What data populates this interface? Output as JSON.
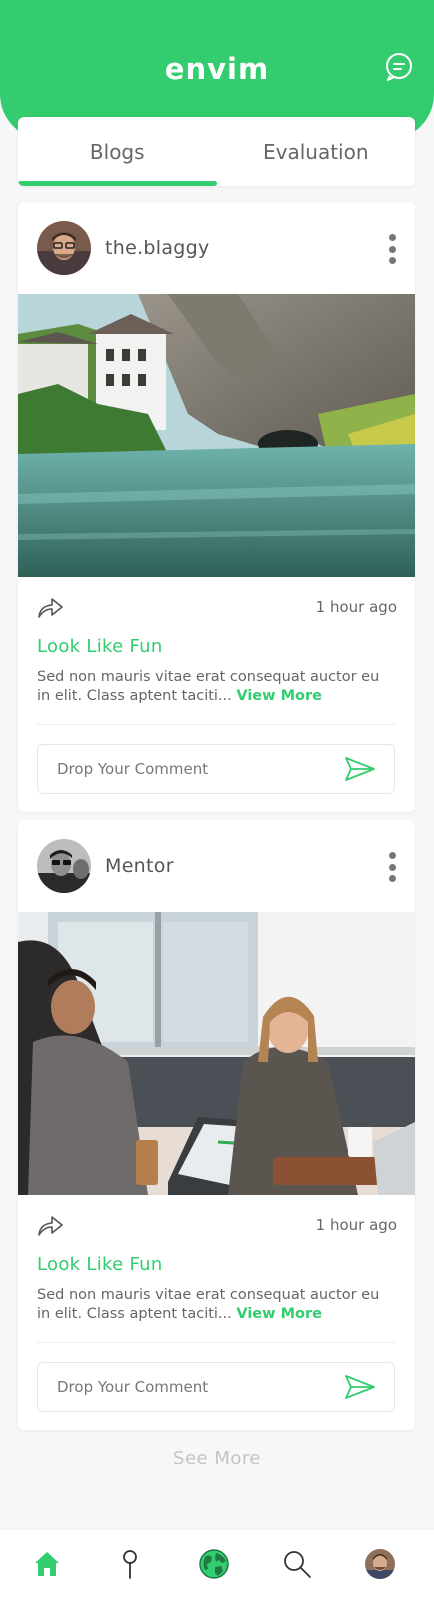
{
  "app": {
    "title": "envim"
  },
  "tabs": [
    {
      "label": "Blogs",
      "active": true
    },
    {
      "label": "Evaluation",
      "active": false
    }
  ],
  "posts": [
    {
      "author": "the.blaggy",
      "time": "1 hour ago",
      "title": "Look Like Fun",
      "excerpt": "Sed non  mauris vitae erat consequat auctor eu in elit. Class aptent taciti...",
      "view_more": "View More",
      "comment_placeholder": "Drop Your Comment"
    },
    {
      "author": "Mentor",
      "time": "1 hour ago",
      "title": "Look Like Fun",
      "excerpt": "Sed non  mauris vitae erat consequat auctor eu in elit. Class aptent taciti...",
      "view_more": "View More",
      "comment_placeholder": "Drop Your Comment"
    }
  ],
  "see_more": "See More",
  "bottom_nav": [
    "home-icon",
    "location-pin-icon",
    "globe-icon",
    "search-icon",
    "profile-avatar"
  ],
  "colors": {
    "accent": "#33cc6e"
  }
}
